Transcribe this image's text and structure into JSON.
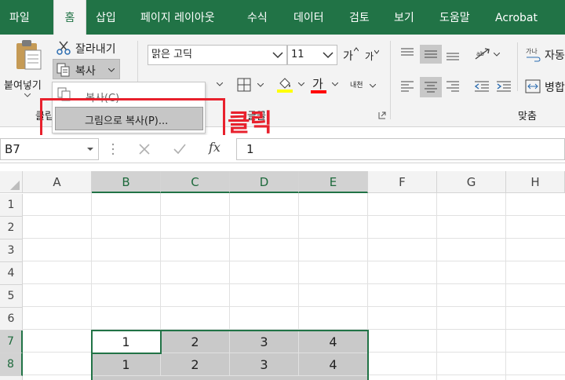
{
  "tabs": [
    "파일",
    "홈",
    "삽입",
    "페이지 레이아웃",
    "수식",
    "데이터",
    "검토",
    "보기",
    "도움말",
    "Acrobat"
  ],
  "active_tab": "홈",
  "clipboard": {
    "paste_label": "붙여넣기",
    "cut_label": "잘라내기",
    "copy_label": "복사",
    "group_label_fragment": "클립"
  },
  "font": {
    "name": "맑은 고딕",
    "size": "11",
    "grow_label": "가",
    "shrink_label": "가",
    "color_label": "가",
    "phonetic_label": "내천",
    "group_label_fragment": "글꼴"
  },
  "alignment": {
    "wrap_label": "자동",
    "merge_label": "병합",
    "group_label": "맞춤"
  },
  "copy_menu": {
    "copy_item": "복사(C)",
    "copy_as_picture_item": "그림으로 복사(P)..."
  },
  "annotation": "클릭",
  "formula_bar": {
    "name_box": "B7",
    "formula_value": "1",
    "fx_label": "fx"
  },
  "columns": [
    "A",
    "B",
    "C",
    "D",
    "E",
    "F",
    "G",
    "H"
  ],
  "selected_columns": [
    "B",
    "C",
    "D",
    "E"
  ],
  "rows": [
    "1",
    "2",
    "3",
    "4",
    "5",
    "6",
    "7",
    "8"
  ],
  "selected_rows": [
    "7",
    "8"
  ],
  "cells": {
    "row7": [
      "1",
      "2",
      "3",
      "4"
    ],
    "row8": [
      "1",
      "2",
      "3",
      "4"
    ]
  },
  "colors": {
    "excel_green": "#217346",
    "highlight_red": "#e8212d",
    "selection_gray": "#c9c9c9",
    "fill_yellow": "#ffff00",
    "font_red": "#ff0000"
  }
}
